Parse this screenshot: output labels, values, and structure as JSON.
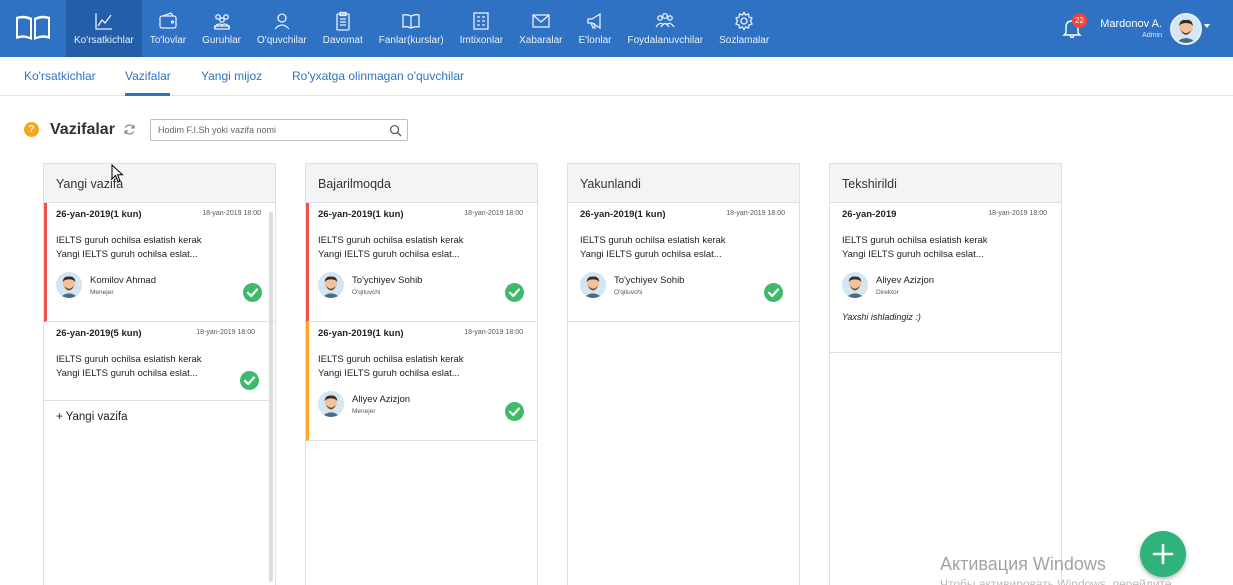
{
  "app": {
    "colors": {
      "primary": "#2f72c4",
      "danger": "#ef5350",
      "warning": "#ffa726",
      "success": "#3fb96a"
    }
  },
  "nav": {
    "items": [
      {
        "label": "Ko'rsatkichlar",
        "icon": "chart-line-icon",
        "active": true
      },
      {
        "label": "To'lovlar",
        "icon": "wallet-icon"
      },
      {
        "label": "Guruhlar",
        "icon": "group-icon"
      },
      {
        "label": "O'quvchilar",
        "icon": "students-icon"
      },
      {
        "label": "Davomat",
        "icon": "clipboard-icon"
      },
      {
        "label": "Fanlar(kurslar)",
        "icon": "book-icon"
      },
      {
        "label": "Imtixonlar",
        "icon": "exam-icon"
      },
      {
        "label": "Xabaralar",
        "icon": "envelope-icon"
      },
      {
        "label": "E'lonlar",
        "icon": "megaphone-icon"
      },
      {
        "label": "Foydalanuvchilar",
        "icon": "users-icon"
      },
      {
        "label": "Sozlamalar",
        "icon": "gear-icon"
      }
    ]
  },
  "notifications": {
    "count": "22"
  },
  "user": {
    "name": "Mardonov A.",
    "role": "Admin"
  },
  "subtabs": [
    {
      "label": "Ko'rsatkichlar"
    },
    {
      "label": "Vazifalar",
      "active": true
    },
    {
      "label": "Yangi mijoz"
    },
    {
      "label": "Ro'yxatga olinmagan o'quvchilar"
    }
  ],
  "header": {
    "help": "?",
    "title": "Vazifalar",
    "search_placeholder": "Hodim F.I.Sh yoki vazifa nomi"
  },
  "columns": [
    {
      "title": "Yangi vazifa",
      "cards": [
        {
          "date": "26-yan-2019(1 kun)",
          "time": "18-yan-2019 18:00",
          "line1": "IELTS guruh ochilsa eslatish kerak",
          "line2": "Yangi IELTS guruh ochilsa eslat...",
          "person": "Komilov Ahmad",
          "role": "Menejer",
          "status": "red",
          "done": true
        },
        {
          "date": "26-yan-2019(5 kun)",
          "time": "18-yan-2019 18:00",
          "line1": "IELTS guruh ochilsa eslatish kerak",
          "line2": "Yangi IELTS guruh ochilsa eslat...",
          "status": "none",
          "done": true
        }
      ],
      "add_label": "+ Yangi vazifa"
    },
    {
      "title": "Bajarilmoqda",
      "cards": [
        {
          "date": "26-yan-2019(1 kun)",
          "time": "18-yan-2019 18:00",
          "line1": "IELTS guruh ochilsa eslatish kerak",
          "line2": "Yangi IELTS guruh ochilsa eslat...",
          "person": "To'ychiyev Sohib",
          "role": "O'qituvchi",
          "status": "red",
          "done": true
        },
        {
          "date": "26-yan-2019(1 kun)",
          "time": "18-yan-2019 18:00",
          "line1": "IELTS guruh ochilsa eslatish kerak",
          "line2": "Yangi IELTS guruh ochilsa eslat...",
          "person": "Aliyev Azizjon",
          "role": "Menejer",
          "status": "orange",
          "done": true
        }
      ]
    },
    {
      "title": "Yakunlandi",
      "cards": [
        {
          "date": "26-yan-2019(1 kun)",
          "time": "18-yan-2019 18:00",
          "line1": "IELTS guruh ochilsa eslatish kerak",
          "line2": "Yangi IELTS guruh ochilsa eslat...",
          "person": "To'ychiyev Sohib",
          "role": "O'qituvchi",
          "status": "none",
          "done": true
        }
      ]
    },
    {
      "title": "Tekshirildi",
      "cards": [
        {
          "date": "26-yan-2019",
          "time": "18-yan-2019 18:00",
          "line1": "IELTS guruh ochilsa eslatish kerak",
          "line2": "Yangi IELTS guruh ochilsa eslat...",
          "person": "Aliyev Azizjon",
          "role": "Direktor",
          "comment": "Yaxshi ishladingiz :)",
          "status": "none",
          "done": false
        }
      ]
    }
  ],
  "fab": {
    "icon": "plus-icon"
  },
  "watermark": {
    "title": "Активация Windows",
    "subtitle": "Чтобы активировать Windows, перейдите"
  }
}
